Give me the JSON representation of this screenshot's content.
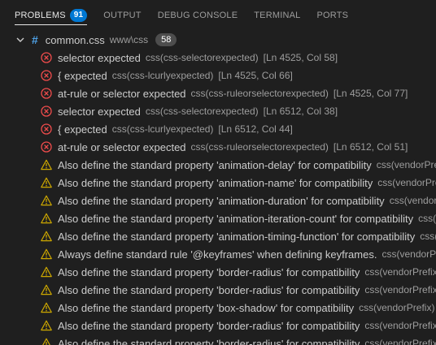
{
  "tabs": [
    {
      "label": "PROBLEMS",
      "badge": "91",
      "active": true
    },
    {
      "label": "OUTPUT"
    },
    {
      "label": "DEBUG CONSOLE"
    },
    {
      "label": "TERMINAL"
    },
    {
      "label": "PORTS"
    }
  ],
  "file": {
    "name": "common.css",
    "path": "www\\css",
    "count": "58",
    "icon": "css-hash-icon"
  },
  "problems": [
    {
      "severity": "error",
      "message": "selector expected",
      "source": "css(css-selectorexpected)",
      "location": "[Ln 4525, Col 58]"
    },
    {
      "severity": "error",
      "message": "{ expected",
      "source": "css(css-lcurlyexpected)",
      "location": "[Ln 4525, Col 66]"
    },
    {
      "severity": "error",
      "message": "at-rule or selector expected",
      "source": "css(css-ruleorselectorexpected)",
      "location": "[Ln 4525, Col 77]"
    },
    {
      "severity": "error",
      "message": "selector expected",
      "source": "css(css-selectorexpected)",
      "location": "[Ln 6512, Col 38]"
    },
    {
      "severity": "error",
      "message": "{ expected",
      "source": "css(css-lcurlyexpected)",
      "location": "[Ln 6512, Col 44]"
    },
    {
      "severity": "error",
      "message": "at-rule or selector expected",
      "source": "css(css-ruleorselectorexpected)",
      "location": "[Ln 6512, Col 51]"
    },
    {
      "severity": "warning",
      "message": "Also define the standard property 'animation-delay' for compatibility",
      "source": "css(vendorPrefix)",
      "location": ""
    },
    {
      "severity": "warning",
      "message": "Also define the standard property 'animation-name' for compatibility",
      "source": "css(vendorPrefix)",
      "location": ""
    },
    {
      "severity": "warning",
      "message": "Also define the standard property 'animation-duration' for compatibility",
      "source": "css(vendorPrefix)",
      "location": ""
    },
    {
      "severity": "warning",
      "message": "Also define the standard property 'animation-iteration-count' for compatibility",
      "source": "css(vendorPrefix)",
      "location": ""
    },
    {
      "severity": "warning",
      "message": "Also define the standard property 'animation-timing-function' for compatibility",
      "source": "css(vendorPrefix)",
      "location": ""
    },
    {
      "severity": "warning",
      "message": "Always define standard rule '@keyframes' when defining keyframes.",
      "source": "css(vendorPrefix)",
      "location": ""
    },
    {
      "severity": "warning",
      "message": "Also define the standard property 'border-radius' for compatibility",
      "source": "css(vendorPrefix)",
      "location": ""
    },
    {
      "severity": "warning",
      "message": "Also define the standard property 'border-radius' for compatibility",
      "source": "css(vendorPrefix)",
      "location": ""
    },
    {
      "severity": "warning",
      "message": "Also define the standard property 'box-shadow' for compatibility",
      "source": "css(vendorPrefix)",
      "location": ""
    },
    {
      "severity": "warning",
      "message": "Also define the standard property 'border-radius' for compatibility",
      "source": "css(vendorPrefix)",
      "location": ""
    },
    {
      "severity": "warning",
      "message": "Also define the standard property 'border-radius' for compatibility",
      "source": "css(vendorPrefix)",
      "location": ""
    }
  ],
  "colors": {
    "background": "#1f1f1f",
    "error": "#f14c4c",
    "warning": "#cca700",
    "accent": "#0078d4"
  }
}
